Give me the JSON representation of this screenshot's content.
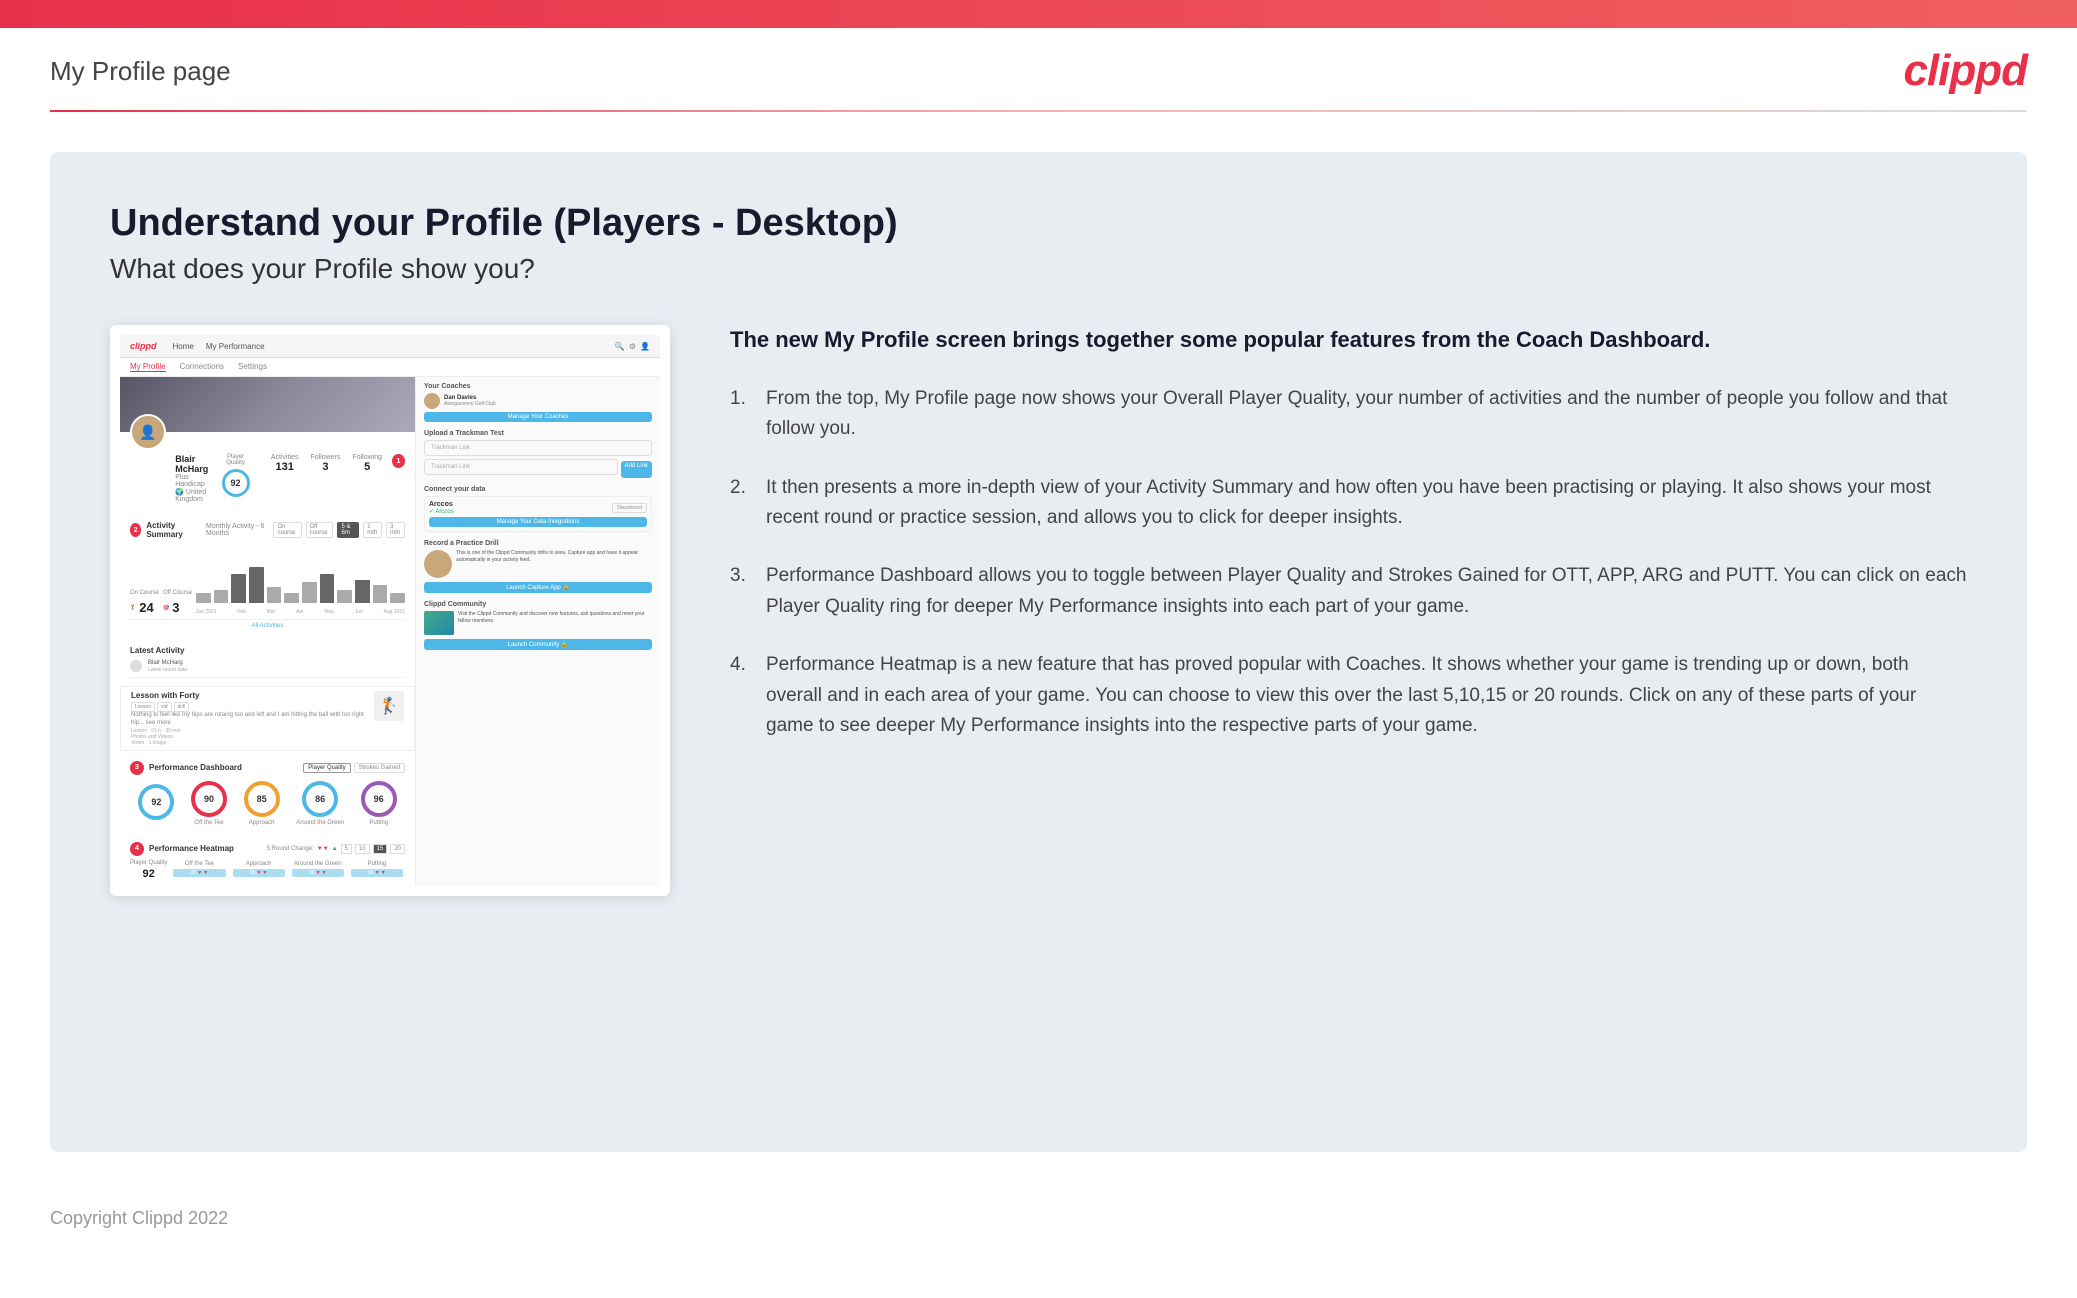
{
  "topbar": {},
  "header": {
    "title": "My Profile page",
    "logo": "clippd"
  },
  "main": {
    "heading": "Understand your Profile (Players - Desktop)",
    "subheading": "What does your Profile show you?",
    "right_intro": "The new My Profile screen brings together some popular features from the Coach Dashboard.",
    "features": [
      {
        "id": 1,
        "text": "From the top, My Profile page now shows your Overall Player Quality, your number of activities and the number of people you follow and that follow you."
      },
      {
        "id": 2,
        "text": "It then presents a more in-depth view of your Activity Summary and how often you have been practising or playing. It also shows your most recent round or practice session, and allows you to click for deeper insights."
      },
      {
        "id": 3,
        "text": "Performance Dashboard allows you to toggle between Player Quality and Strokes Gained for OTT, APP, ARG and PUTT. You can click on each Player Quality ring for deeper My Performance insights into each part of your game."
      },
      {
        "id": 4,
        "text": "Performance Heatmap is a new feature that has proved popular with Coaches. It shows whether your game is trending up or down, both overall and in each area of your game. You can choose to view this over the last 5,10,15 or 20 rounds. Click on any of these parts of your game to see deeper My Performance insights into the respective parts of your game."
      }
    ],
    "mockup": {
      "nav_items": [
        "Home",
        "My Performance"
      ],
      "subnav_items": [
        "My Profile",
        "Connections",
        "Settings"
      ],
      "player_name": "Blair McHarg",
      "player_handicap": "Plus Handicap",
      "player_location": "United Kingdom",
      "player_quality": 92,
      "activities": 131,
      "followers": 3,
      "following": 5,
      "on_course": 24,
      "off_course": 3,
      "perf_rings": [
        {
          "value": 92,
          "label": "",
          "color": "#4db8e8"
        },
        {
          "value": 90,
          "label": "Off the Tee",
          "color": "#e8304a"
        },
        {
          "value": 85,
          "label": "Approach",
          "color": "#f0a030"
        },
        {
          "value": 86,
          "label": "Around the Green",
          "color": "#4db8e8"
        },
        {
          "value": 96,
          "label": "Putting",
          "color": "#9b59b6"
        }
      ],
      "heatmap": {
        "overall": 92,
        "categories": [
          {
            "label": "Off the Tee",
            "value": "90",
            "trend": "down"
          },
          {
            "label": "Approach",
            "value": "85",
            "trend": "down"
          },
          {
            "label": "Around the Green",
            "value": "86",
            "trend": "down"
          },
          {
            "label": "Putting",
            "value": "96",
            "trend": "down"
          }
        ],
        "round_options": [
          "5",
          "10",
          "15",
          "20"
        ]
      },
      "coach_name": "Dan Davies",
      "coach_club": "Abergavenny Golf Club",
      "latest_activity_title": "Blair McHarg",
      "lesson_title": "Lesson with Forty",
      "lesson_desc": "Nothing to feel like my hips are rotaing too and left and I am hitting the ball with too right hip... see more",
      "community_title": "Clippd Community",
      "connect_app": "Arccos"
    }
  },
  "footer": {
    "copyright": "Copyright Clippd 2022"
  }
}
